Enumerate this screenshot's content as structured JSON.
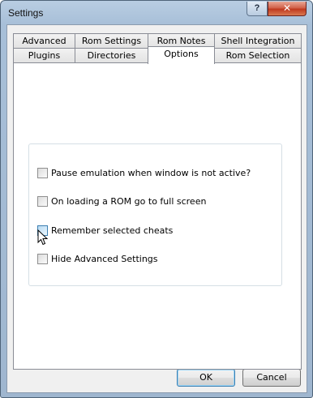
{
  "window": {
    "title": "Settings",
    "help_label": "?",
    "close_label": "✕"
  },
  "tabs": {
    "row_top": [
      "Advanced",
      "Rom Settings",
      "Rom Notes",
      "Shell Integration"
    ],
    "row_bottom": [
      "Plugins",
      "Directories",
      "Options",
      "Rom Selection"
    ],
    "active": "Options"
  },
  "options": {
    "items": [
      {
        "label": "Pause emulation when window is not active?",
        "checked": false
      },
      {
        "label": "On loading a ROM go to full screen",
        "checked": false
      },
      {
        "label": "Remember selected cheats",
        "checked": false
      },
      {
        "label": "Hide Advanced Settings",
        "checked": false
      }
    ]
  },
  "buttons": {
    "ok": "OK",
    "cancel": "Cancel"
  },
  "icons": {
    "help": "help-icon",
    "close": "close-icon",
    "cursor": "mouse-pointer-icon"
  }
}
